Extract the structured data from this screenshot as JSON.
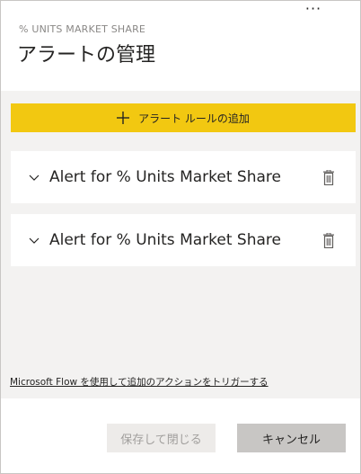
{
  "header": {
    "more_label": "···",
    "subtitle": "% UNITS MARKET SHARE",
    "title": "アラートの管理"
  },
  "toolbar": {
    "add_rule_label": "アラート ルールの追加"
  },
  "alerts": [
    {
      "name": "Alert for % Units Market Share"
    },
    {
      "name": "Alert for % Units Market Share"
    }
  ],
  "flow_link": "Microsoft Flow を使用して追加のアクションをトリガーする",
  "footer": {
    "save_label": "保存して閉じる",
    "cancel_label": "キャンセル"
  },
  "colors": {
    "accent": "#f2c811",
    "panel_bg": "#f3f2f1",
    "disabled_text": "#a19f9d"
  },
  "icons": {
    "add": "plus-icon",
    "expand": "chevron-down-icon",
    "delete": "trash-icon",
    "more": "more-icon"
  }
}
